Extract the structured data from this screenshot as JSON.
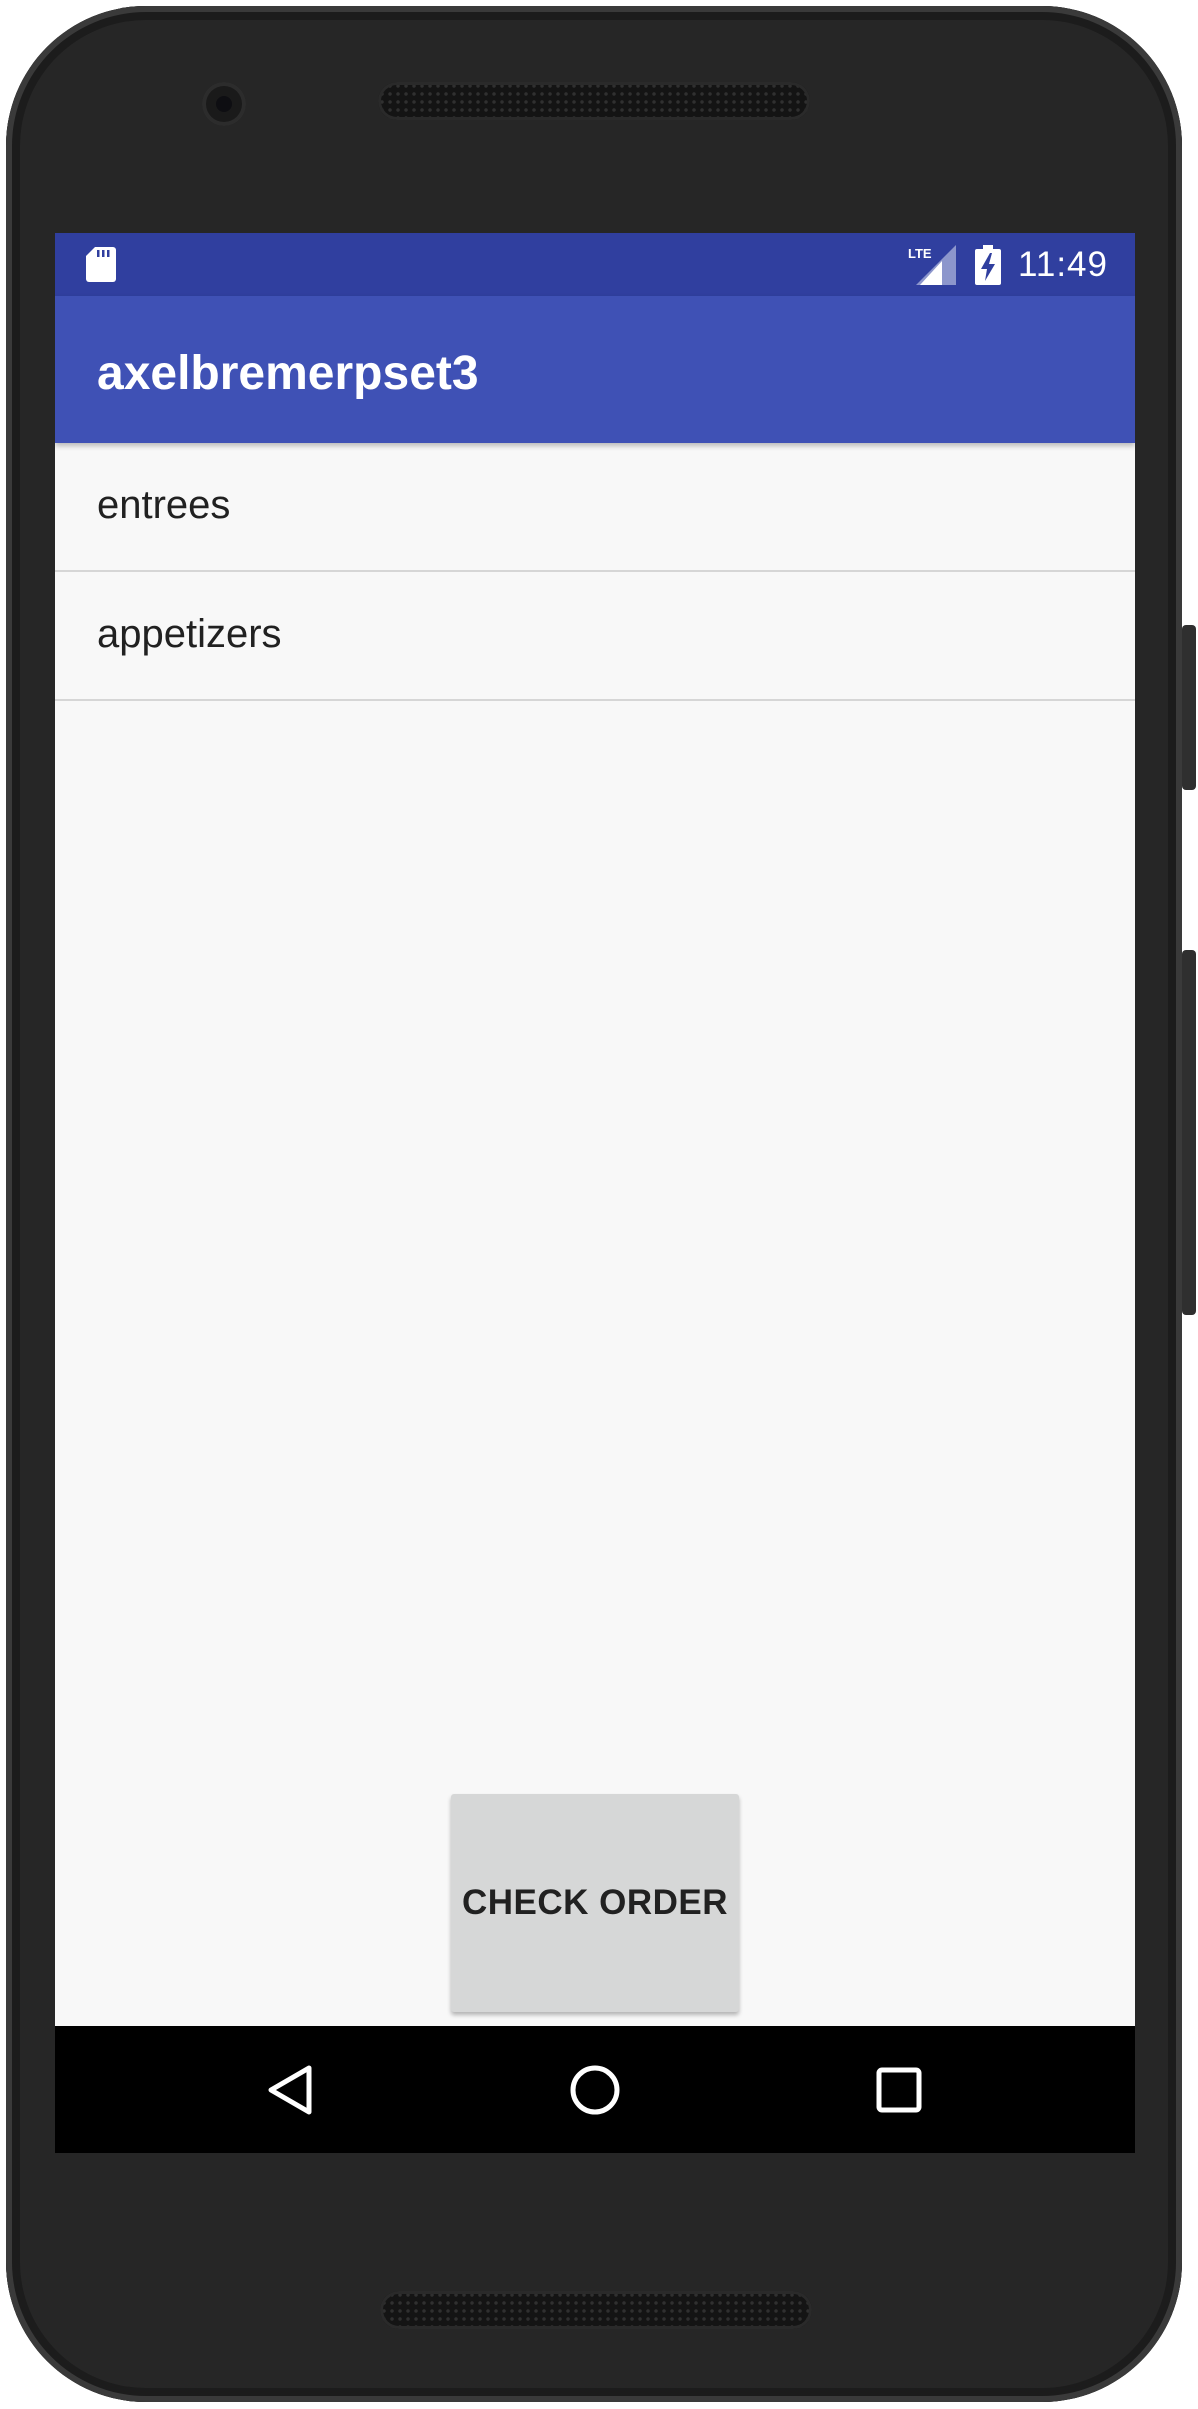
{
  "status_bar": {
    "time": "11:49",
    "network_label": "LTE",
    "icons": [
      "sd-card-icon",
      "lte-signal-icon",
      "battery-charging-icon"
    ]
  },
  "app_bar": {
    "title": "axelbremerpset3"
  },
  "categories": [
    {
      "label": "entrees"
    },
    {
      "label": "appetizers"
    }
  ],
  "check_order_button": {
    "label": "CHECK ORDER"
  },
  "nav_bar": {
    "icons": [
      "back-icon",
      "home-icon",
      "recents-icon"
    ]
  },
  "colors": {
    "status_bar": "#303f9f",
    "app_bar": "#3f51b5",
    "background": "#f8f8f8",
    "button": "#d6d7d7",
    "divider": "#d6d6d6"
  }
}
